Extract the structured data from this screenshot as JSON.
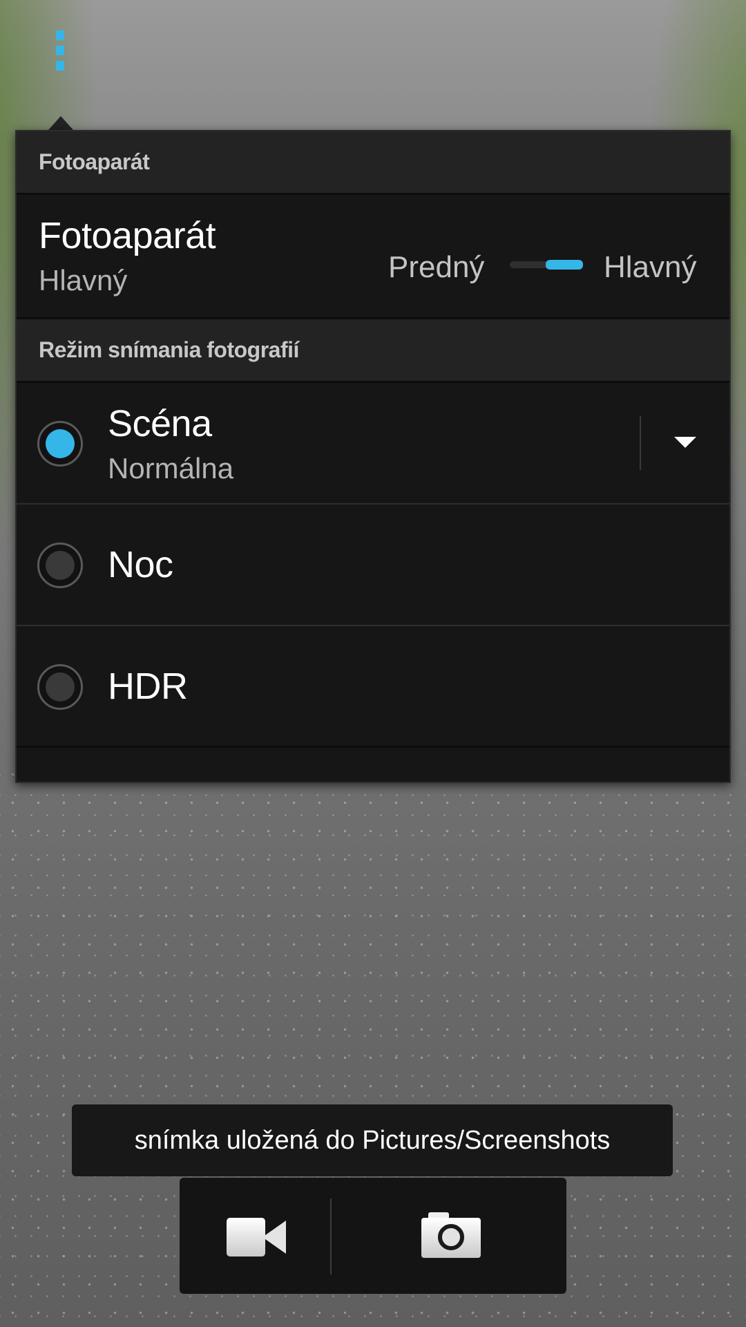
{
  "popup": {
    "section_camera_header": "Fotoaparát",
    "camera_row": {
      "title": "Fotoaparát",
      "subtitle": "Hlavný",
      "toggle_left_label": "Predný",
      "toggle_right_label": "Hlavný",
      "toggle_selected": "Hlavný"
    },
    "section_mode_header": "Režim snímania fotografií",
    "modes": [
      {
        "label": "Scéna",
        "sublabel": "Normálna",
        "checked": true,
        "has_dropdown": true
      },
      {
        "label": "Noc",
        "checked": false
      },
      {
        "label": "HDR",
        "checked": false
      }
    ]
  },
  "toast": {
    "text": "snímka uložená do Pictures/Screenshots"
  },
  "mode_bar": {
    "video_icon": "video-camera-icon",
    "photo_icon": "camera-icon"
  },
  "menu_icon": "overflow-menu-icon",
  "colors": {
    "accent": "#35b6e8",
    "panel_bg": "#161616",
    "header_bg": "#232323",
    "toast_bg": "#181818"
  }
}
